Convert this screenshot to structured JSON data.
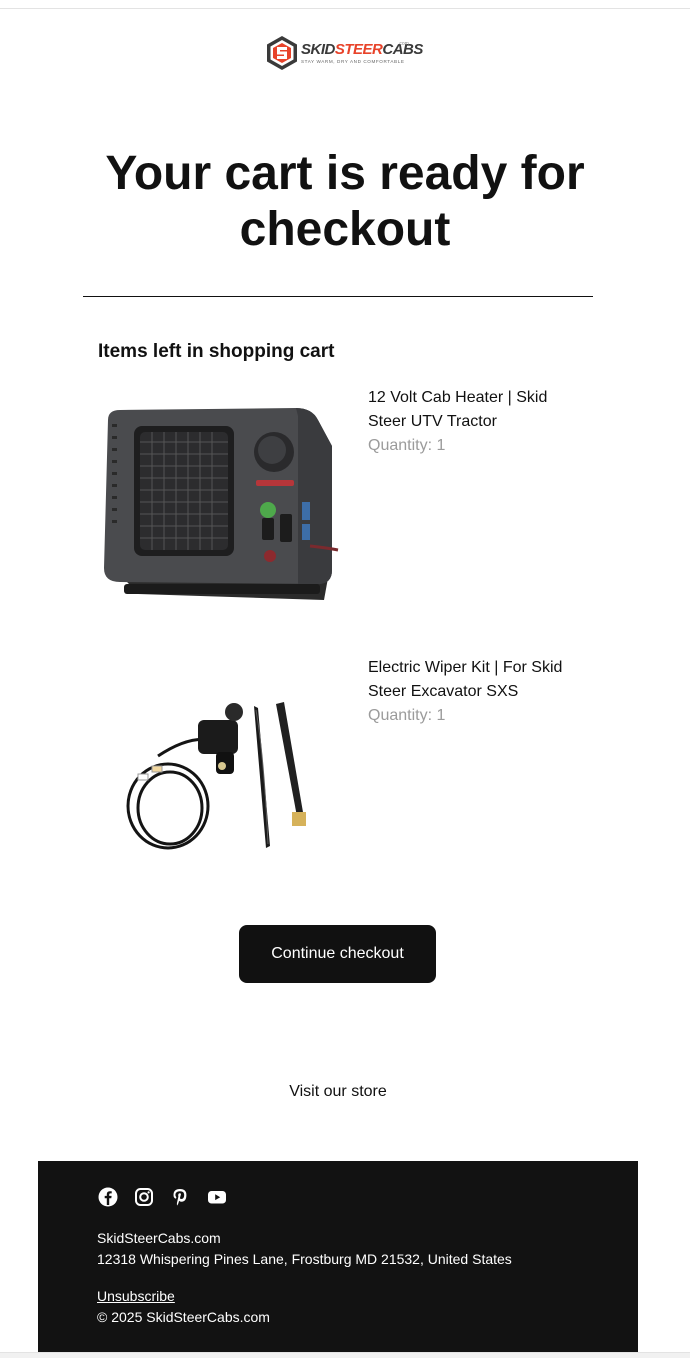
{
  "brand": {
    "logo_word_dark": "SKID",
    "logo_word_red": "STEER",
    "logo_word_end": "CABS",
    "logo_sup": ".com",
    "logo_tagline": "STAY WARM, DRY AND COMFORTABLE"
  },
  "headline": "Your cart is ready for checkout",
  "cart": {
    "section_title": "Items left in shopping cart",
    "items": [
      {
        "name": "12 Volt Cab Heater | Skid Steer UTV Tractor",
        "quantity": "Quantity: 1",
        "image_icon": "cab-heater-image"
      },
      {
        "name": "Electric Wiper Kit | For Skid Steer Excavator SXS",
        "quantity": "Quantity: 1",
        "image_icon": "wiper-kit-image"
      }
    ]
  },
  "cta_label": "Continue checkout",
  "store_link": "Visit our store",
  "footer": {
    "social_icons": [
      "facebook-icon",
      "instagram-icon",
      "pinterest-icon",
      "youtube-icon"
    ],
    "company": "SkidSteerCabs.com",
    "address": "12318 Whispering Pines Lane, Frostburg MD 21532, United States",
    "unsubscribe": "Unsubscribe",
    "copyright": "© 2025 SkidSteerCabs.com"
  },
  "colors": {
    "accent_dark": "#111111",
    "logo_red": "#e8432a",
    "muted_text": "#9b9b9b",
    "footer_bg": "#121212"
  }
}
